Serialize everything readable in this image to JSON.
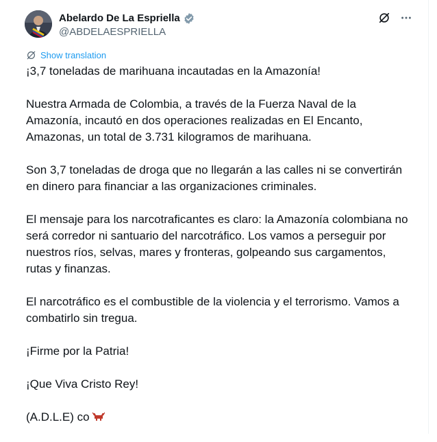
{
  "author": {
    "display_name": "Abelardo De La Espriella",
    "handle": "@ABDELAESPRIELLA",
    "verified": true
  },
  "actions": {
    "grok_icon": "grok-icon",
    "more_icon": "more-options-icon"
  },
  "translation": {
    "label": "Show translation"
  },
  "tweet": {
    "paragraphs": [
      "¡3,7 toneladas de marihuana incautadas en la Amazonía!",
      "Nuestra Armada de Colombia, a través de la Fuerza Naval de la Amazonía, incautó en dos operaciones realizadas en El Encanto, Amazonas, un total de 3.731 kilogramos de marihuana.",
      "Son 3,7 toneladas de droga que no llegarán a las calles ni se convertirán en dinero para financiar a las organizaciones criminales.",
      "El mensaje para los narcotraficantes es claro: la Amazonía colombiana no será corredor ni santuario del narcotráfico. Los vamos a perseguir por nuestros ríos, selvas, mares y fronteras, golpeando sus cargamentos, rutas y finanzas.",
      "El narcotráfico es el combustible de la violencia y el terrorismo. Vamos a combatirlo sin tregua.",
      "¡Firme por la Patria!",
      "¡Que Viva Cristo Rey!",
      "(A.D.L.E) co"
    ],
    "signature_emoji": "bull-emoji"
  },
  "colors": {
    "link": "#1d9bf0",
    "secondary_text": "#536471",
    "primary_text": "#0f1419",
    "verified_badge": "#829aab"
  }
}
